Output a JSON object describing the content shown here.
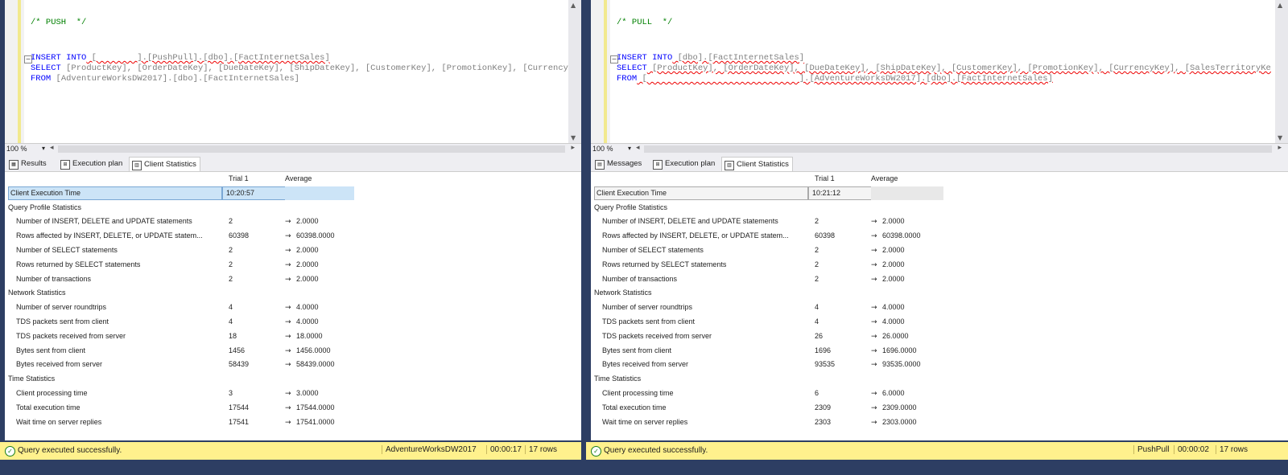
{
  "left": {
    "code": {
      "comment": "/* PUSH  */",
      "line1_kw": "INSERT INTO",
      "line1_rest": " [        ].[PushPull].[dbo].[FactInternetSales]",
      "line2_kw": "SELECT",
      "line2_rest": " [ProductKey], [OrderDateKey], [DueDateKey], [ShipDateKey], [CustomerKey], [PromotionKey], [Currency",
      "line3_kw": "FROM",
      "line3_rest": " [AdventureWorksDW2017].[dbo].[FactInternetSales]"
    },
    "zoom": "100 %",
    "tabs": [
      "Results",
      "Execution plan",
      "Client Statistics"
    ],
    "active_tab": 2,
    "header": {
      "trial": "Trial 1",
      "average": "Average"
    },
    "client_exec": {
      "label": "Client Execution Time",
      "value": "10:20:57"
    },
    "sections": [
      {
        "title": "Query Profile Statistics",
        "rows": [
          {
            "label": "Number of INSERT, DELETE and UPDATE statements",
            "trial": "2",
            "avg": "2.0000"
          },
          {
            "label": "Rows affected by INSERT, DELETE, or UPDATE statem...",
            "trial": "60398",
            "avg": "60398.0000"
          },
          {
            "label": "Number of SELECT statements",
            "trial": "2",
            "avg": "2.0000"
          },
          {
            "label": "Rows returned by SELECT statements",
            "trial": "2",
            "avg": "2.0000"
          },
          {
            "label": "Number of transactions",
            "trial": "2",
            "avg": "2.0000"
          }
        ]
      },
      {
        "title": "Network Statistics",
        "rows": [
          {
            "label": "Number of server roundtrips",
            "trial": "4",
            "avg": "4.0000"
          },
          {
            "label": "TDS packets sent from client",
            "trial": "4",
            "avg": "4.0000"
          },
          {
            "label": "TDS packets received from server",
            "trial": "18",
            "avg": "18.0000"
          },
          {
            "label": "Bytes sent from client",
            "trial": "1456",
            "avg": "1456.0000"
          },
          {
            "label": "Bytes received from server",
            "trial": "58439",
            "avg": "58439.0000"
          }
        ]
      },
      {
        "title": "Time Statistics",
        "rows": [
          {
            "label": "Client processing time",
            "trial": "3",
            "avg": "3.0000"
          },
          {
            "label": "Total execution time",
            "trial": "17544",
            "avg": "17544.0000"
          },
          {
            "label": "Wait time on server replies",
            "trial": "17541",
            "avg": "17541.0000"
          }
        ]
      }
    ],
    "status": {
      "message": "Query executed successfully.",
      "db": "AdventureWorksDW2017",
      "time": "00:00:17",
      "rows": "17 rows"
    }
  },
  "right": {
    "code": {
      "comment": "/* PULL  */",
      "line1_kw": "INSERT INTO",
      "line1_rest": " [dbo].[FactInternetSales]",
      "line2_kw": "SELECT",
      "line2_rest": " [ProductKey], [OrderDateKey], [DueDateKey], [ShipDateKey], [CustomerKey], [PromotionKey], [CurrencyKey], [SalesTerritoryKe",
      "line3_kw": "FROM",
      "line3_rest": " [                              ].[AdventureWorksDW2017].[dbo].[FactInternetSales]"
    },
    "zoom": "100 %",
    "tabs": [
      "Messages",
      "Execution plan",
      "Client Statistics"
    ],
    "active_tab": 2,
    "header": {
      "trial": "Trial 1",
      "average": "Average"
    },
    "client_exec": {
      "label": "Client Execution Time",
      "value": "10:21:12"
    },
    "sections": [
      {
        "title": "Query Profile Statistics",
        "rows": [
          {
            "label": "Number of INSERT, DELETE and UPDATE statements",
            "trial": "2",
            "avg": "2.0000"
          },
          {
            "label": "Rows affected by INSERT, DELETE, or UPDATE statem...",
            "trial": "60398",
            "avg": "60398.0000"
          },
          {
            "label": "Number of SELECT statements",
            "trial": "2",
            "avg": "2.0000"
          },
          {
            "label": "Rows returned by SELECT statements",
            "trial": "2",
            "avg": "2.0000"
          },
          {
            "label": "Number of transactions",
            "trial": "2",
            "avg": "2.0000"
          }
        ]
      },
      {
        "title": "Network Statistics",
        "rows": [
          {
            "label": "Number of server roundtrips",
            "trial": "4",
            "avg": "4.0000"
          },
          {
            "label": "TDS packets sent from client",
            "trial": "4",
            "avg": "4.0000"
          },
          {
            "label": "TDS packets received from server",
            "trial": "26",
            "avg": "26.0000"
          },
          {
            "label": "Bytes sent from client",
            "trial": "1696",
            "avg": "1696.0000"
          },
          {
            "label": "Bytes received from server",
            "trial": "93535",
            "avg": "93535.0000"
          }
        ]
      },
      {
        "title": "Time Statistics",
        "rows": [
          {
            "label": "Client processing time",
            "trial": "6",
            "avg": "6.0000"
          },
          {
            "label": "Total execution time",
            "trial": "2309",
            "avg": "2309.0000"
          },
          {
            "label": "Wait time on server replies",
            "trial": "2303",
            "avg": "2303.0000"
          }
        ]
      }
    ],
    "status": {
      "message": "Query executed successfully.",
      "db": "PushPull",
      "time": "00:00:02",
      "rows": "17 rows"
    }
  },
  "arrow_glyph": "→"
}
